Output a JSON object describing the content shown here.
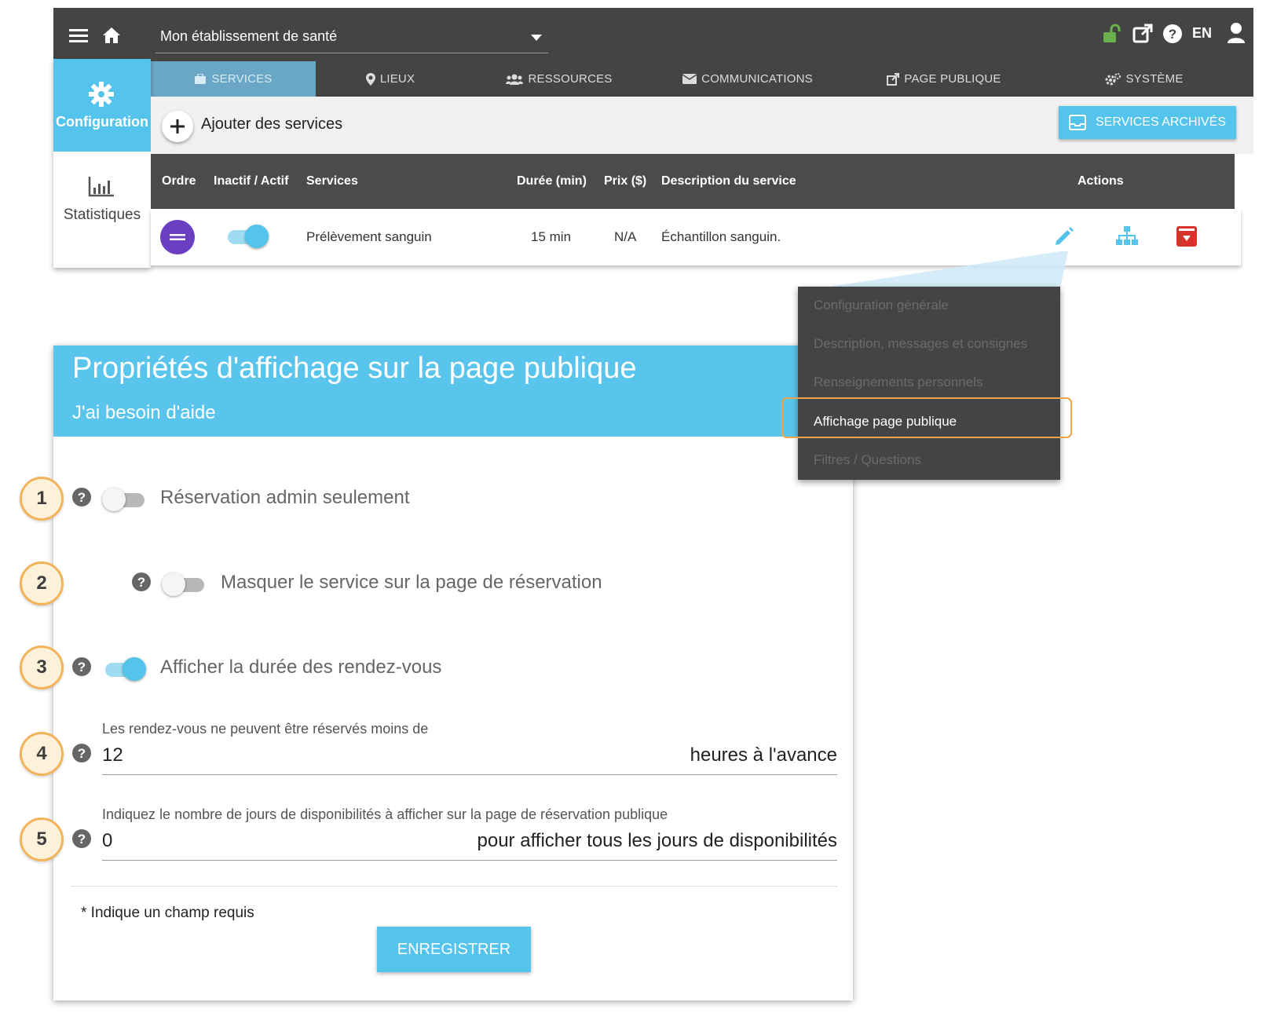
{
  "topbar": {
    "establishment": "Mon établissement de santé",
    "language": "EN"
  },
  "tabs": [
    {
      "label": "SERVICES",
      "icon": "briefcase-icon",
      "active": true
    },
    {
      "label": "LIEUX",
      "icon": "map-marker-icon",
      "active": false
    },
    {
      "label": "RESSOURCES",
      "icon": "users-icon",
      "active": false
    },
    {
      "label": "COMMUNICATIONS",
      "icon": "envelope-icon",
      "active": false
    },
    {
      "label": "PAGE PUBLIQUE",
      "icon": "external-link-icon",
      "active": false
    },
    {
      "label": "SYSTÈME",
      "icon": "gears-icon",
      "active": false
    }
  ],
  "sidebar": {
    "configuration": "Configuration",
    "statistiques": "Statistiques"
  },
  "toolbar": {
    "add_label": "Ajouter des services",
    "archived_button": "SERVICES ARCHIVÉS"
  },
  "table": {
    "headers": {
      "order": "Ordre",
      "active": "Inactif / Actif",
      "services": "Services",
      "duration": "Durée (min)",
      "price": "Prix ($)",
      "description": "Description du service",
      "actions": "Actions"
    },
    "rows": [
      {
        "service": "Prélèvement sanguin",
        "duration": "15 min",
        "price": "N/A",
        "description": "Échantillon sanguin.",
        "active": true
      }
    ]
  },
  "menu": {
    "items": [
      "Configuration générale",
      "Description, messages et consignes",
      "Renseignements personnels",
      "Affichage page publique",
      "Filtres / Questions"
    ],
    "highlighted_index": 3
  },
  "panel": {
    "title": "Propriétés d'affichage sur la page publique",
    "help": "J'ai besoin d'aide",
    "options": [
      {
        "number": "1",
        "label": "Réservation admin seulement",
        "on": false
      },
      {
        "number": "2",
        "label": "Masquer le service sur la page de réservation",
        "on": false
      },
      {
        "number": "3",
        "label": "Afficher la durée des rendez-vous",
        "on": true
      }
    ],
    "fields": [
      {
        "number": "4",
        "label": "Les rendez-vous ne peuvent être réservés moins de",
        "value": "12",
        "suffix": "heures à l'avance"
      },
      {
        "number": "5",
        "label": "Indiquez le nombre de jours de disponibilités à afficher sur la page de réservation publique",
        "value": "0",
        "suffix": "pour afficher tous les jours de disponibilités"
      }
    ],
    "required_note": "* Indique un champ requis",
    "save_button": "ENREGISTRER"
  },
  "colors": {
    "accent": "#54c4ec",
    "dark_bar": "#444444",
    "order_handle": "#6a3fc1",
    "archive_red": "#d9322b",
    "lock_green": "#6ab04c",
    "callout_orange": "#f3b35a"
  }
}
